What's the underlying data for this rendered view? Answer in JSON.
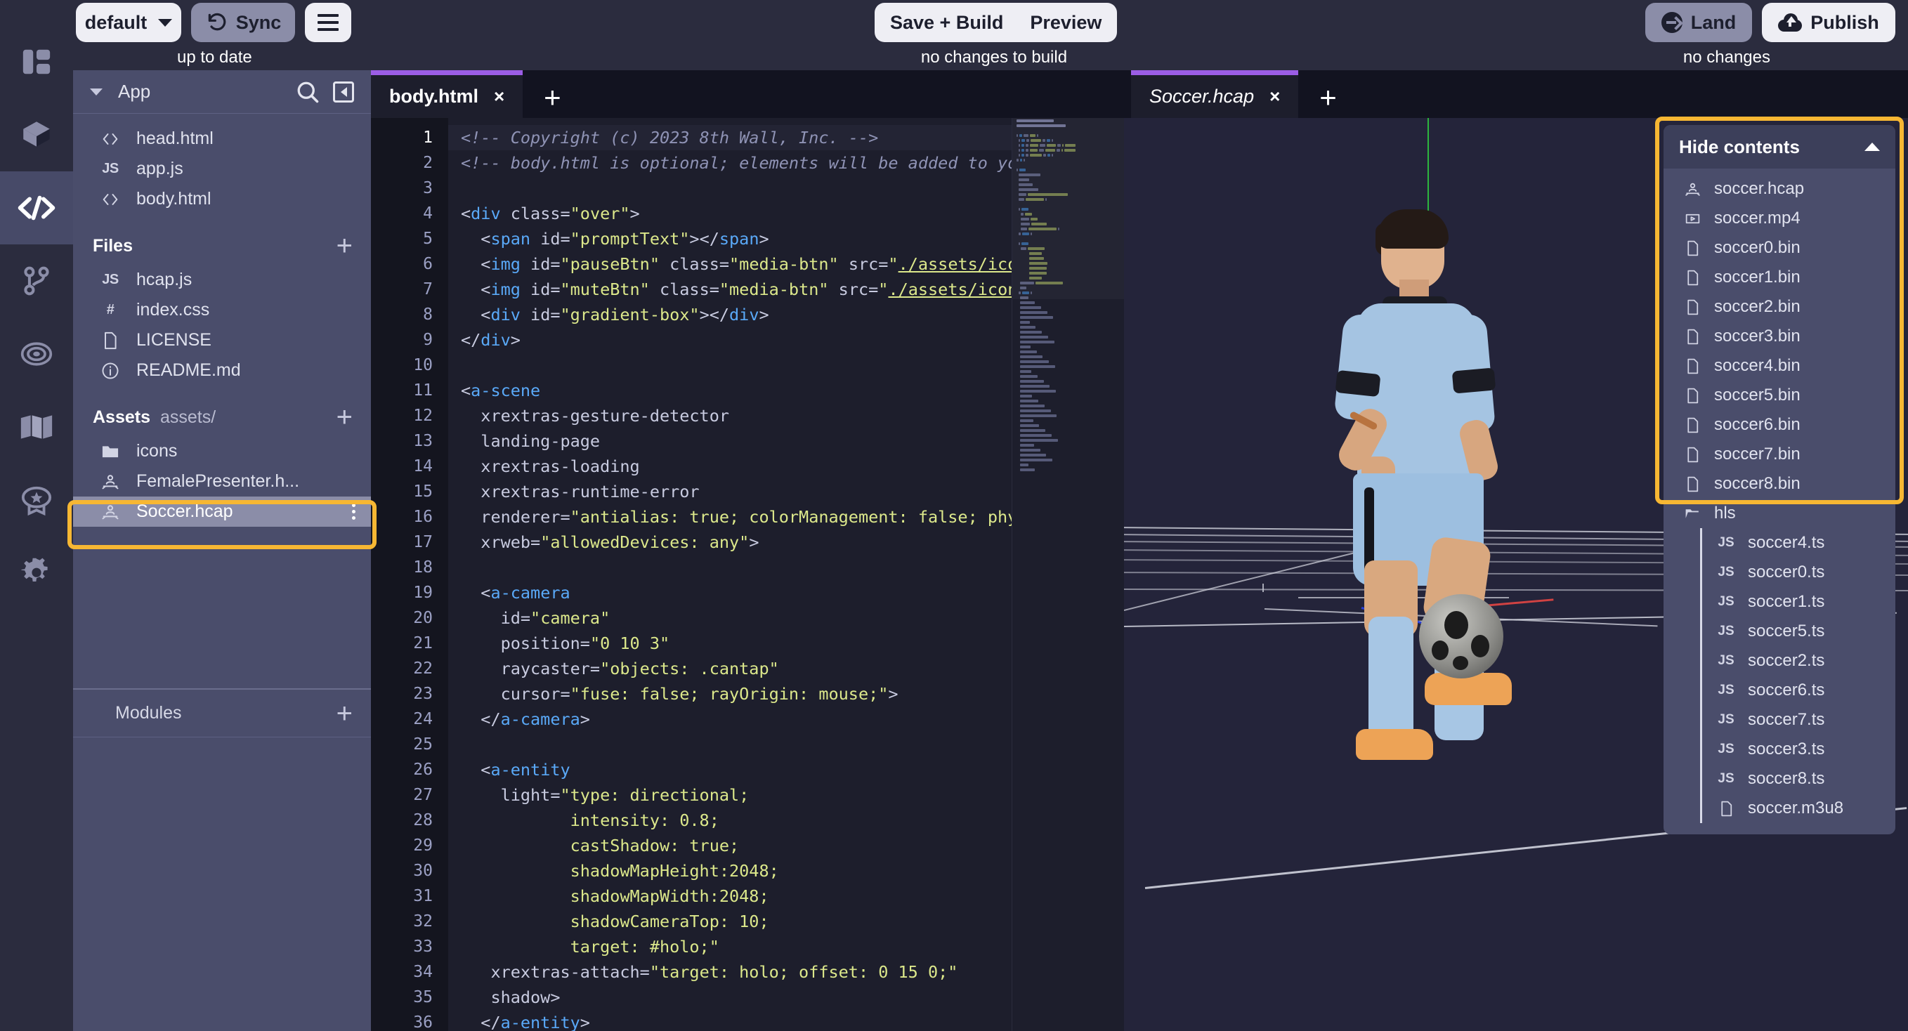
{
  "topbar": {
    "env_selector": "default",
    "sync_button": "Sync",
    "sync_status": "up to date",
    "save_build_button": "Save + Build",
    "preview_button": "Preview",
    "build_status": "no changes to build",
    "land_button": "Land",
    "publish_button": "Publish",
    "publish_status": "no changes"
  },
  "rail": {
    "items": [
      {
        "icon": "layout-panels-icon",
        "name": "sidebar-item-layout",
        "active": false
      },
      {
        "icon": "cube-icon",
        "name": "sidebar-item-assets",
        "active": false
      },
      {
        "icon": "code-brackets-icon",
        "name": "sidebar-item-code",
        "active": true
      },
      {
        "icon": "git-branch-icon",
        "name": "sidebar-item-version-control",
        "active": false
      },
      {
        "icon": "target-icon",
        "name": "sidebar-item-targets",
        "active": false
      },
      {
        "icon": "map-icon",
        "name": "sidebar-item-map",
        "active": false
      },
      {
        "icon": "badge-star-icon",
        "name": "sidebar-item-rewards",
        "active": false
      },
      {
        "icon": "gear-icon",
        "name": "sidebar-item-settings",
        "active": false
      }
    ]
  },
  "filepanel": {
    "title": "App",
    "search_icon": "search-icon",
    "collapse_icon": "collapse-panel-icon",
    "app_files": [
      {
        "icon": "html",
        "label": "head.html"
      },
      {
        "icon": "js",
        "label": "app.js"
      },
      {
        "icon": "html",
        "label": "body.html"
      }
    ],
    "files_section": {
      "title": "Files",
      "add": "+"
    },
    "files": [
      {
        "icon": "js",
        "label": "hcap.js"
      },
      {
        "icon": "css",
        "label": "index.css"
      },
      {
        "icon": "doc",
        "label": "LICENSE"
      },
      {
        "icon": "info",
        "label": "README.md"
      }
    ],
    "assets_section": {
      "title": "Assets",
      "path": "assets/",
      "add": "+"
    },
    "assets": [
      {
        "icon": "folder",
        "label": "icons",
        "selected": false
      },
      {
        "icon": "hcap",
        "label": "FemalePresenter.h...",
        "selected": false
      },
      {
        "icon": "hcap",
        "label": "Soccer.hcap",
        "selected": true,
        "menu": "kebab-icon"
      }
    ],
    "modules_section": {
      "title": "Modules",
      "add": "+"
    }
  },
  "editor": {
    "tabs": [
      {
        "label": "body.html",
        "close": "×",
        "active": true,
        "italic": false
      }
    ],
    "add_tab": "+",
    "current_line": 1,
    "lines": [
      {
        "n": 1,
        "tokens": [
          {
            "t": "comment",
            "s": "<!-- Copyright (c) 2023 8th Wall, Inc. -->"
          }
        ]
      },
      {
        "n": 2,
        "tokens": [
          {
            "t": "comment",
            "s": "<!-- body.html is optional; elements will be added to yo"
          }
        ]
      },
      {
        "n": 3,
        "tokens": []
      },
      {
        "n": 4,
        "tokens": [
          {
            "t": "plain",
            "s": "<"
          },
          {
            "t": "tag",
            "s": "div"
          },
          {
            "t": "plain",
            "s": " class="
          },
          {
            "t": "str",
            "s": "\"over\""
          },
          {
            "t": "plain",
            "s": ">"
          }
        ]
      },
      {
        "n": 5,
        "tokens": [
          {
            "t": "plain",
            "s": "  <"
          },
          {
            "t": "tag",
            "s": "span"
          },
          {
            "t": "plain",
            "s": " id="
          },
          {
            "t": "str",
            "s": "\"promptText\""
          },
          {
            "t": "plain",
            "s": "></"
          },
          {
            "t": "tag",
            "s": "span"
          },
          {
            "t": "plain",
            "s": ">"
          }
        ]
      },
      {
        "n": 6,
        "tokens": [
          {
            "t": "plain",
            "s": "  <"
          },
          {
            "t": "tag",
            "s": "img"
          },
          {
            "t": "plain",
            "s": " id="
          },
          {
            "t": "str",
            "s": "\"pauseBtn\""
          },
          {
            "t": "plain",
            "s": " class="
          },
          {
            "t": "str",
            "s": "\"media-btn\""
          },
          {
            "t": "plain",
            "s": " src="
          },
          {
            "t": "str",
            "s": "\""
          },
          {
            "t": "link",
            "s": "./assets/ico"
          }
        ]
      },
      {
        "n": 7,
        "tokens": [
          {
            "t": "plain",
            "s": "  <"
          },
          {
            "t": "tag",
            "s": "img"
          },
          {
            "t": "plain",
            "s": " id="
          },
          {
            "t": "str",
            "s": "\"muteBtn\""
          },
          {
            "t": "plain",
            "s": " class="
          },
          {
            "t": "str",
            "s": "\"media-btn\""
          },
          {
            "t": "plain",
            "s": " src="
          },
          {
            "t": "str",
            "s": "\""
          },
          {
            "t": "link",
            "s": "./assets/icon"
          }
        ]
      },
      {
        "n": 8,
        "tokens": [
          {
            "t": "plain",
            "s": "  <"
          },
          {
            "t": "tag",
            "s": "div"
          },
          {
            "t": "plain",
            "s": " id="
          },
          {
            "t": "str",
            "s": "\"gradient-box\""
          },
          {
            "t": "plain",
            "s": "></"
          },
          {
            "t": "tag",
            "s": "div"
          },
          {
            "t": "plain",
            "s": ">"
          }
        ]
      },
      {
        "n": 9,
        "tokens": [
          {
            "t": "plain",
            "s": "</"
          },
          {
            "t": "tag",
            "s": "div"
          },
          {
            "t": "plain",
            "s": ">"
          }
        ]
      },
      {
        "n": 10,
        "tokens": []
      },
      {
        "n": 11,
        "tokens": [
          {
            "t": "plain",
            "s": "<"
          },
          {
            "t": "tag",
            "s": "a-scene"
          }
        ]
      },
      {
        "n": 12,
        "tokens": [
          {
            "t": "plain",
            "s": "  xrextras-gesture-detector"
          }
        ]
      },
      {
        "n": 13,
        "tokens": [
          {
            "t": "plain",
            "s": "  landing-page"
          }
        ]
      },
      {
        "n": 14,
        "tokens": [
          {
            "t": "plain",
            "s": "  xrextras-loading"
          }
        ]
      },
      {
        "n": 15,
        "tokens": [
          {
            "t": "plain",
            "s": "  xrextras-runtime-error"
          }
        ]
      },
      {
        "n": 16,
        "tokens": [
          {
            "t": "plain",
            "s": "  renderer="
          },
          {
            "t": "str",
            "s": "\"antialias: true; colorManagement: false; phy"
          }
        ]
      },
      {
        "n": 17,
        "tokens": [
          {
            "t": "plain",
            "s": "  xrweb="
          },
          {
            "t": "str",
            "s": "\"allowedDevices: any\""
          },
          {
            "t": "plain",
            "s": ">"
          }
        ]
      },
      {
        "n": 18,
        "tokens": []
      },
      {
        "n": 19,
        "tokens": [
          {
            "t": "plain",
            "s": "  <"
          },
          {
            "t": "tag",
            "s": "a-camera"
          }
        ]
      },
      {
        "n": 20,
        "tokens": [
          {
            "t": "plain",
            "s": "    id="
          },
          {
            "t": "str",
            "s": "\"camera\""
          }
        ]
      },
      {
        "n": 21,
        "tokens": [
          {
            "t": "plain",
            "s": "    position="
          },
          {
            "t": "str",
            "s": "\"0 10 3\""
          }
        ]
      },
      {
        "n": 22,
        "tokens": [
          {
            "t": "plain",
            "s": "    raycaster="
          },
          {
            "t": "str",
            "s": "\"objects: .cantap\""
          }
        ]
      },
      {
        "n": 23,
        "tokens": [
          {
            "t": "plain",
            "s": "    cursor="
          },
          {
            "t": "str",
            "s": "\"fuse: false; rayOrigin: mouse;\""
          },
          {
            "t": "plain",
            "s": ">"
          }
        ]
      },
      {
        "n": 24,
        "tokens": [
          {
            "t": "plain",
            "s": "  </"
          },
          {
            "t": "tag",
            "s": "a-camera"
          },
          {
            "t": "plain",
            "s": ">"
          }
        ]
      },
      {
        "n": 25,
        "tokens": []
      },
      {
        "n": 26,
        "tokens": [
          {
            "t": "plain",
            "s": "  <"
          },
          {
            "t": "tag",
            "s": "a-entity"
          }
        ]
      },
      {
        "n": 27,
        "tokens": [
          {
            "t": "plain",
            "s": "    light="
          },
          {
            "t": "str",
            "s": "\"type: directional;"
          }
        ]
      },
      {
        "n": 28,
        "tokens": [
          {
            "t": "str",
            "s": "           intensity: 0.8;"
          }
        ]
      },
      {
        "n": 29,
        "tokens": [
          {
            "t": "str",
            "s": "           castShadow: true;"
          }
        ]
      },
      {
        "n": 30,
        "tokens": [
          {
            "t": "str",
            "s": "           shadowMapHeight:2048;"
          }
        ]
      },
      {
        "n": 31,
        "tokens": [
          {
            "t": "str",
            "s": "           shadowMapWidth:2048;"
          }
        ]
      },
      {
        "n": 32,
        "tokens": [
          {
            "t": "str",
            "s": "           shadowCameraTop: 10;"
          }
        ]
      },
      {
        "n": 33,
        "tokens": [
          {
            "t": "str",
            "s": "           target: #holo;\""
          }
        ]
      },
      {
        "n": 34,
        "tokens": [
          {
            "t": "plain",
            "s": "   xrextras-attach="
          },
          {
            "t": "str",
            "s": "\"target: holo; offset: 0 15 0;\""
          }
        ]
      },
      {
        "n": 35,
        "tokens": [
          {
            "t": "plain",
            "s": "   shadow>"
          }
        ]
      },
      {
        "n": 36,
        "tokens": [
          {
            "t": "plain",
            "s": "  </"
          },
          {
            "t": "tag",
            "s": "a-entity"
          },
          {
            "t": "plain",
            "s": ">"
          }
        ]
      }
    ]
  },
  "viewport": {
    "tabs": [
      {
        "label": "Soccer.hcap",
        "close": "×",
        "active": true,
        "italic": true
      }
    ],
    "add_tab": "+"
  },
  "contents": {
    "header": "Hide contents",
    "toggle_icon": "chevron-up-icon",
    "items": [
      {
        "icon": "hcap",
        "label": "soccer.hcap",
        "nested": false
      },
      {
        "icon": "video",
        "label": "soccer.mp4",
        "nested": false
      },
      {
        "icon": "doc",
        "label": "soccer0.bin",
        "nested": false
      },
      {
        "icon": "doc",
        "label": "soccer1.bin",
        "nested": false
      },
      {
        "icon": "doc",
        "label": "soccer2.bin",
        "nested": false
      },
      {
        "icon": "doc",
        "label": "soccer3.bin",
        "nested": false
      },
      {
        "icon": "doc",
        "label": "soccer4.bin",
        "nested": false
      },
      {
        "icon": "doc",
        "label": "soccer5.bin",
        "nested": false
      },
      {
        "icon": "doc",
        "label": "soccer6.bin",
        "nested": false
      },
      {
        "icon": "doc",
        "label": "soccer7.bin",
        "nested": false
      },
      {
        "icon": "doc",
        "label": "soccer8.bin",
        "nested": false
      },
      {
        "icon": "folder-open",
        "label": "hls",
        "nested": false
      },
      {
        "icon": "js",
        "label": "soccer4.ts",
        "nested": true
      },
      {
        "icon": "js",
        "label": "soccer0.ts",
        "nested": true
      },
      {
        "icon": "js",
        "label": "soccer1.ts",
        "nested": true
      },
      {
        "icon": "js",
        "label": "soccer5.ts",
        "nested": true
      },
      {
        "icon": "js",
        "label": "soccer2.ts",
        "nested": true
      },
      {
        "icon": "js",
        "label": "soccer6.ts",
        "nested": true
      },
      {
        "icon": "js",
        "label": "soccer7.ts",
        "nested": true
      },
      {
        "icon": "js",
        "label": "soccer3.ts",
        "nested": true
      },
      {
        "icon": "js",
        "label": "soccer8.ts",
        "nested": true
      },
      {
        "icon": "doc",
        "label": "soccer.m3u8",
        "nested": true
      }
    ]
  },
  "colors": {
    "highlight": "#f7b733",
    "accent_tab": "#9b5de5",
    "panel": "#4a4d6b",
    "chrome": "#2b2c3e",
    "editor_bg": "#1d1e2c"
  }
}
